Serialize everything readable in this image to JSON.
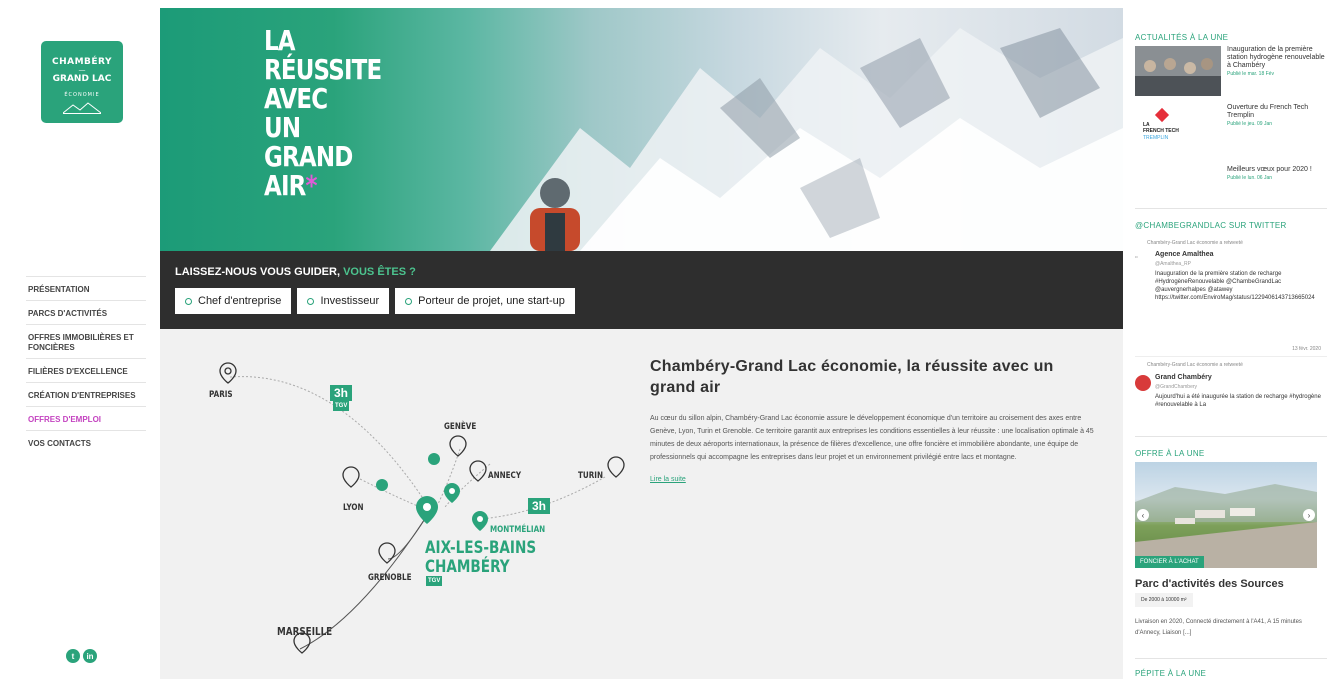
{
  "logo": {
    "line1": "CHAMBÉRY",
    "line2": "—",
    "line3": "GRAND LAC",
    "line4": "ÉCONOMIE"
  },
  "nav": [
    {
      "label": "PRÉSENTATION"
    },
    {
      "label": "PARCS D'ACTIVITÉS"
    },
    {
      "label": "OFFRES IMMOBILIÈRES ET FONCIÈRES"
    },
    {
      "label": "FILIÈRES D'EXCELLENCE"
    },
    {
      "label": "CRÉATION D'ENTREPRISES"
    },
    {
      "label": "OFFRES D'EMPLOI"
    },
    {
      "label": "VOS CONTACTS"
    }
  ],
  "hero": {
    "title": "LA\nRÉUSSITE\nAVEC\nUN\nGRAND\nAIR",
    "star": "*"
  },
  "guide": {
    "title": "LAISSEZ-NOUS VOUS GUIDER,",
    "accent": "VOUS ÊTES ?",
    "buttons": [
      "Chef d'entreprise",
      "Investisseur",
      "Porteur de projet, une start-up"
    ]
  },
  "map": {
    "cities": {
      "paris": "PARIS",
      "geneve": "GENÈVE",
      "annecy": "ANNECY",
      "turin": "TURIN",
      "lyon": "LYON",
      "montmelian": "MONTMÉLIAN",
      "grenoble": "GRENOBLE",
      "marseille": "MARSEILLE"
    },
    "main_city_1": "AIX-LES-BAINS",
    "main_city_2": "CHAMBÉRY",
    "badge_paris": "3h",
    "badge_turin": "3h",
    "tgv": "TGV"
  },
  "content": {
    "title": "Chambéry-Grand Lac économie, la réussite avec un grand air",
    "body": "Au cœur du sillon alpin, Chambéry-Grand Lac économie assure le développement économique d'un territoire au croisement des axes entre Genève, Lyon, Turin et Grenoble. Ce territoire garantit aux entreprises les conditions essentielles à leur réussite : une localisation optimale à 45 minutes de deux aéroports internationaux, la présence de filières d'excellence, une offre foncière et immobilière abondante, une équipe de professionnels qui accompagne les entreprises dans leur projet et un environnement privilégié entre lacs et montagne.",
    "more": "Lire la suite"
  },
  "right": {
    "news_title": "ACTUALITÉS À LA UNE",
    "news": [
      {
        "title": "Inauguration de la première station hydrogène renouvelable à Chambéry",
        "date": "Publié le mar. 18 Fév"
      },
      {
        "title": "Ouverture du French Tech Tremplin",
        "date": "Publié le jeu. 09 Jan"
      },
      {
        "title": "Meilleurs vœux pour 2020 !",
        "date": "Publié le lun. 06 Jan"
      }
    ],
    "frenchtech": {
      "la": "LA",
      "ft": "FRENCH TECH",
      "tr": "TREMPLIN"
    },
    "twitter_title": "@CHAMBEGRANDLAC SUR TWITTER",
    "tweets": [
      {
        "retweet": "Chambéry-Grand Lac économie a retweeté",
        "name": "Agence Amalthea",
        "handle": "@Amalthea_RP",
        "body": "Inauguration de la première station de recharge #HydrogèneRenouvelable @ChambeGrandLac @auvergnerhalpes @atawey https://twitter.com/EnviroMag/status/1229406143713665024",
        "date": "13 févr. 2020"
      },
      {
        "retweet": "Chambéry-Grand Lac économie a retweeté",
        "name": "Grand Chambéry",
        "handle": "@GrandChambery",
        "body": "Aujourd'hui a été inaugurée la station de recharge #hydrogène #renouvelable à La"
      }
    ],
    "offer_title": "OFFRE À LA UNE",
    "offer_tag": "FONCIER À L'ACHAT",
    "offer_name": "Parc d'activités des Sources",
    "offer_chip": "De 2000 à 10000 m²",
    "offer_desc": "Livraison en 2020, Connecté directement à l'A41, A 15 minutes d'Annecy, Liaison [...]",
    "pepite_title": "PÉPITE À LA UNE"
  }
}
